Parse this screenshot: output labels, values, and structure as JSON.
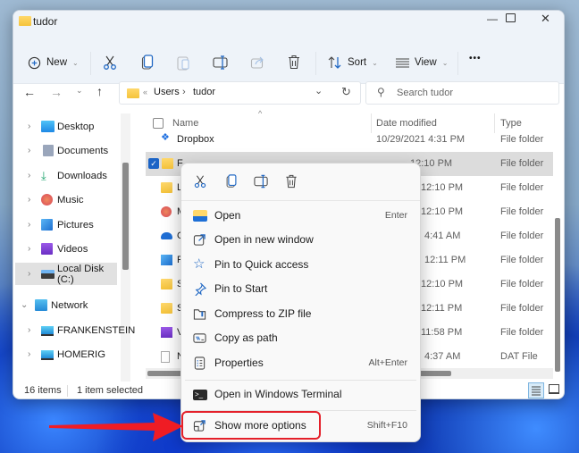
{
  "window": {
    "title": "tudor",
    "controls": {
      "minimize": "—",
      "maximize": "☐",
      "close": "✕"
    }
  },
  "toolbar": {
    "new_label": "New",
    "sort_label": "Sort",
    "view_label": "View",
    "more_label": "•••"
  },
  "address": {
    "overflow": "«",
    "crumbs": [
      "Users",
      "tudor"
    ],
    "separator": "›",
    "search_placeholder": "Search tudor"
  },
  "sidebar": {
    "items": [
      {
        "label": "Desktop",
        "icon": "desktop-icon",
        "color": "#29a4e6"
      },
      {
        "label": "Documents",
        "icon": "documents-icon",
        "color": "#8a99b5"
      },
      {
        "label": "Downloads",
        "icon": "downloads-icon",
        "color": "#1aa26a"
      },
      {
        "label": "Music",
        "icon": "music-icon",
        "color": "#e05a4b"
      },
      {
        "label": "Pictures",
        "icon": "pictures-icon",
        "color": "#2d8ee0"
      },
      {
        "label": "Videos",
        "icon": "videos-icon",
        "color": "#7b3fd6"
      },
      {
        "label": "Local Disk (C:)",
        "icon": "drive-icon",
        "color": "#4f8fd8"
      },
      {
        "label": "Network",
        "icon": "network-icon",
        "color": "#2b95d8"
      },
      {
        "label": "FRANKENSTEIN",
        "icon": "computer-icon",
        "color": "#2b95d8"
      },
      {
        "label": "HOMERIG",
        "icon": "computer-icon",
        "color": "#2b95d8"
      }
    ]
  },
  "list": {
    "columns": {
      "name": "Name",
      "date": "Date modified",
      "type": "Type"
    },
    "rows": [
      {
        "name": "Dropbox",
        "date": "10/29/2021 4:31 PM",
        "type": "File folder",
        "icon": "dropbox-icon"
      },
      {
        "name": "F",
        "date": "12:10 PM",
        "type": "File folder",
        "icon": "folder-icon",
        "selected": true
      },
      {
        "name": "L",
        "date": "12:10 PM",
        "type": "File folder",
        "icon": "folder-icon"
      },
      {
        "name": "M",
        "date": "12:10 PM",
        "type": "File folder",
        "icon": "music-icon"
      },
      {
        "name": "O",
        "date": "4:41 AM",
        "type": "File folder",
        "icon": "onedrive-icon"
      },
      {
        "name": "P",
        "date": "12:11 PM",
        "type": "File folder",
        "icon": "pictures-icon"
      },
      {
        "name": "S",
        "date": "12:10 PM",
        "type": "File folder",
        "icon": "folder-icon"
      },
      {
        "name": "S",
        "date": "12:11 PM",
        "type": "File folder",
        "icon": "folder-icon"
      },
      {
        "name": "V",
        "date": "11:58 PM",
        "type": "File folder",
        "icon": "videos-icon"
      },
      {
        "name": "N",
        "date": "4:37 AM",
        "type": "DAT File",
        "icon": "file-icon"
      }
    ]
  },
  "status": {
    "count": "16 items",
    "selection": "1 item selected"
  },
  "context_menu": {
    "quick_actions": [
      "cut",
      "copy",
      "rename",
      "delete"
    ],
    "items": [
      {
        "label": "Open",
        "shortcut": "Enter",
        "icon": "open-folder-icon"
      },
      {
        "label": "Open in new window",
        "shortcut": "",
        "icon": "new-window-icon"
      },
      {
        "label": "Pin to Quick access",
        "shortcut": "",
        "icon": "star-icon"
      },
      {
        "label": "Pin to Start",
        "shortcut": "",
        "icon": "pin-icon"
      },
      {
        "label": "Compress to ZIP file",
        "shortcut": "",
        "icon": "zip-icon"
      },
      {
        "label": "Copy as path",
        "shortcut": "",
        "icon": "copy-path-icon"
      },
      {
        "label": "Properties",
        "shortcut": "Alt+Enter",
        "icon": "properties-icon"
      },
      {
        "label": "Open in Windows Terminal",
        "shortcut": "",
        "icon": "terminal-icon"
      },
      {
        "label": "Show more options",
        "shortcut": "Shift+F10",
        "icon": "more-options-icon"
      }
    ]
  },
  "annotation": {
    "color": "#e4202a"
  }
}
